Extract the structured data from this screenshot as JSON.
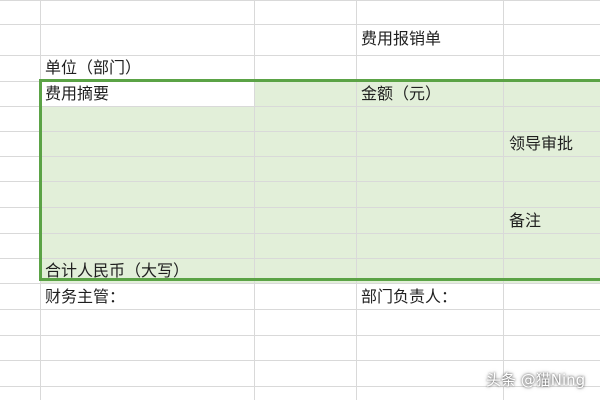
{
  "sheet": {
    "title": "费用报销单",
    "unit_label": "单位（部门）",
    "expense_summary_label": "费用摘要",
    "amount_label": "金额（元）",
    "approval_label": "领导审批",
    "remarks_label": "备注",
    "total_rmb_label": "合计人民币（大写）",
    "finance_supervisor_label": "财务主管：",
    "department_head_label": "部门负责人："
  },
  "watermark": {
    "text": "头条 @猫Ning"
  },
  "colors": {
    "grid_line": "#d9d9d9",
    "selection_fill": "#e2efd9",
    "selection_border": "#5ba346",
    "active_cell": "#ffffff"
  }
}
